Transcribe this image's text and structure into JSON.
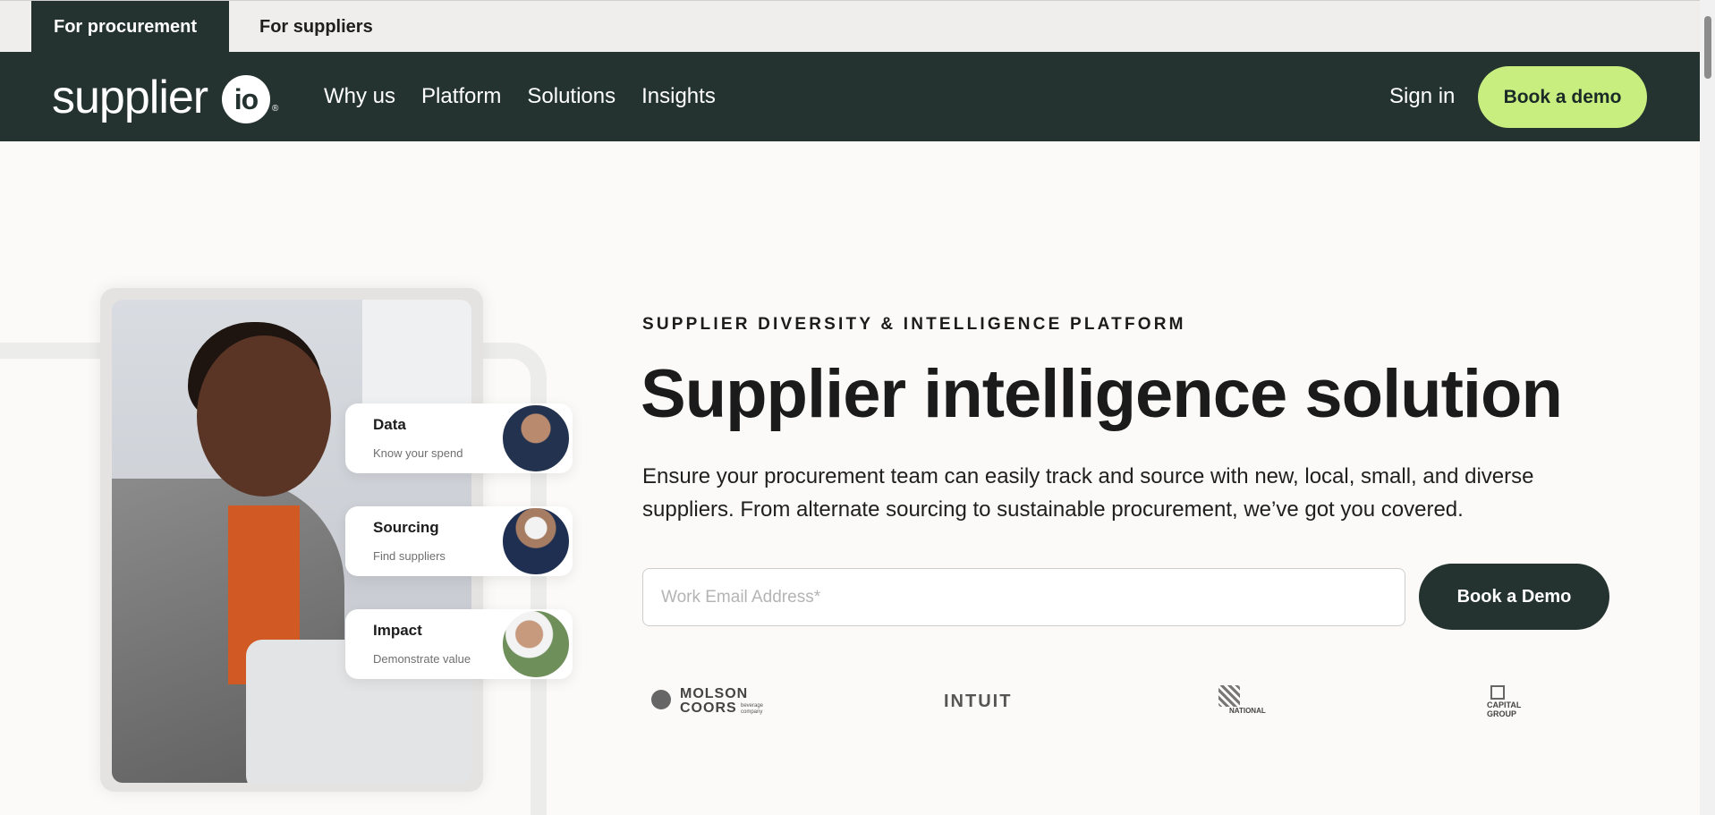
{
  "audience_tabs": {
    "procurement": "For procurement",
    "suppliers": "For suppliers"
  },
  "nav": {
    "logo_word": "supplier",
    "logo_circle": "io",
    "logo_mark": "®",
    "links": [
      "Why us",
      "Platform",
      "Solutions",
      "Insights"
    ],
    "sign_in": "Sign in",
    "book_demo": "Book a demo"
  },
  "hero": {
    "eyebrow": "SUPPLIER DIVERSITY & INTELLIGENCE PLATFORM",
    "headline": "Supplier intelligence solution",
    "lede": "Ensure your procurement team can easily track and source with new, local, small, and diverse suppliers. From alternate sourcing to sustainable procurement, we’ve got you covered.",
    "email_placeholder": "Work Email Address*",
    "email_value": "",
    "cta": "Book a Demo"
  },
  "cards": [
    {
      "title": "Data",
      "subtitle": "Know your spend"
    },
    {
      "title": "Sourcing",
      "subtitle": "Find suppliers"
    },
    {
      "title": "Impact",
      "subtitle": "Demonstrate value"
    }
  ],
  "client_logos": {
    "molson_coors": {
      "line1": "MOLSON",
      "line2": "COORS",
      "tagline": "beverage company"
    },
    "intuit": "INTUIT",
    "national": "NATIONAL",
    "capital_group": {
      "line1": "CAPITAL",
      "line2": "GROUP"
    }
  },
  "colors": {
    "brand_dark": "#243330",
    "accent_lime": "#c8ee7f",
    "background": "#fbfaf8"
  }
}
